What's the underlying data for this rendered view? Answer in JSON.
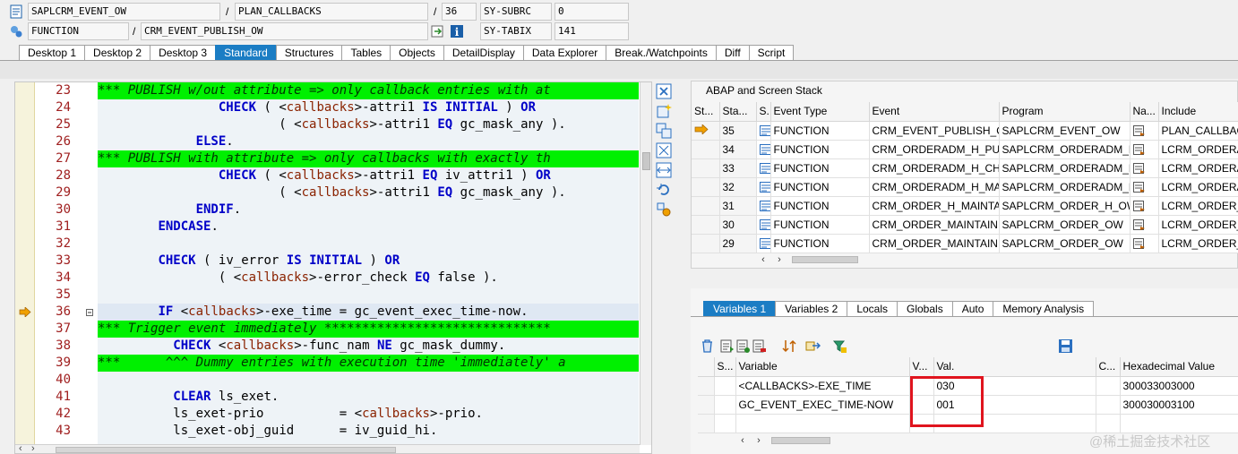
{
  "header": {
    "program_field": "SAPLCRM_EVENT_OW",
    "include_field": "PLAN_CALLBACKS",
    "line_field": "36",
    "subrc_label": "SY-SUBRC",
    "subrc_value": "0",
    "event_type_field": "FUNCTION",
    "event_field": "CRM_EVENT_PUBLISH_OW",
    "tabix_label": "SY-TABIX",
    "tabix_value": "141",
    "slash": "/"
  },
  "tabs": [
    "Desktop 1",
    "Desktop 2",
    "Desktop 3",
    "Standard",
    "Structures",
    "Tables",
    "Objects",
    "DetailDisplay",
    "Data Explorer",
    "Break./Watchpoints",
    "Diff",
    "Script"
  ],
  "active_tab": "Standard",
  "code": {
    "lines": [
      {
        "no": "23",
        "text": "*** PUBLISH w/out attribute => only callback entries with at",
        "green": true
      },
      {
        "no": "24",
        "text": "                CHECK ( <callbacks>-attri1 IS INITIAL ) OR"
      },
      {
        "no": "25",
        "text": "                        ( <callbacks>-attri1 EQ gc_mask_any )."
      },
      {
        "no": "26",
        "text": "             ELSE."
      },
      {
        "no": "27",
        "text": "*** PUBLISH with attribute => only callbacks with exactly th",
        "green": true
      },
      {
        "no": "28",
        "text": "                CHECK ( <callbacks>-attri1 EQ iv_attri1 ) OR"
      },
      {
        "no": "29",
        "text": "                        ( <callbacks>-attri1 EQ gc_mask_any )."
      },
      {
        "no": "30",
        "text": "             ENDIF."
      },
      {
        "no": "31",
        "text": "        ENDCASE."
      },
      {
        "no": "32",
        "text": ""
      },
      {
        "no": "33",
        "text": "        CHECK ( iv_error IS INITIAL ) OR"
      },
      {
        "no": "34",
        "text": "                ( <callbacks>-error_check EQ false )."
      },
      {
        "no": "35",
        "text": ""
      },
      {
        "no": "36",
        "text": "        IF <callbacks>-exe_time = gc_event_exec_time-now.",
        "current": true
      },
      {
        "no": "37",
        "text": "*** Trigger event immediately ******************************",
        "green": true
      },
      {
        "no": "38",
        "text": "          CHECK <callbacks>-func_nam NE gc_mask_dummy."
      },
      {
        "no": "39",
        "text": "***      ^^^ Dummy entries with execution time 'immediately' a",
        "green": true
      },
      {
        "no": "40",
        "text": ""
      },
      {
        "no": "41",
        "text": "          CLEAR ls_exet."
      },
      {
        "no": "42",
        "text": "          ls_exet-prio          = <callbacks>-prio."
      },
      {
        "no": "43",
        "text": "          ls_exet-obj_guid      = iv_guid_hi."
      }
    ],
    "keywords": [
      "CHECK",
      "IS",
      "INITIAL",
      "OR",
      "EQ",
      "ELSE",
      "ENDIF",
      "ENDCASE",
      "IF",
      "NE",
      "CLEAR"
    ]
  },
  "stack": {
    "title": "ABAP and Screen Stack",
    "columns": [
      "St...",
      "Sta...",
      "S...",
      "Event Type",
      "Event",
      "Program",
      "Na...",
      "Include"
    ],
    "rows": [
      {
        "level": "35",
        "type": "FUNCTION",
        "event": "CRM_EVENT_PUBLISH_O...",
        "program": "SAPLCRM_EVENT_OW",
        "include": "PLAN_CALLBACKS",
        "current": true
      },
      {
        "level": "34",
        "type": "FUNCTION",
        "event": "CRM_ORDERADM_H_PUB...",
        "program": "SAPLCRM_ORDERADM_H...",
        "include": "LCRM_ORDERADM_H..."
      },
      {
        "level": "33",
        "type": "FUNCTION",
        "event": "CRM_ORDERADM_H_CHA...",
        "program": "SAPLCRM_ORDERADM_H...",
        "include": "LCRM_ORDERADM_H..."
      },
      {
        "level": "32",
        "type": "FUNCTION",
        "event": "CRM_ORDERADM_H_MAI...",
        "program": "SAPLCRM_ORDERADM_H...",
        "include": "LCRM_ORDERADM_H..."
      },
      {
        "level": "31",
        "type": "FUNCTION",
        "event": "CRM_ORDER_H_MAINTA...",
        "program": "SAPLCRM_ORDER_H_OW",
        "include": "LCRM_ORDER_H_O..."
      },
      {
        "level": "30",
        "type": "FUNCTION",
        "event": "CRM_ORDER_MAINTAIN...",
        "program": "SAPLCRM_ORDER_OW",
        "include": "LCRM_ORDER_OW..."
      },
      {
        "level": "29",
        "type": "FUNCTION",
        "event": "CRM_ORDER_MAINTAIN...",
        "program": "SAPLCRM_ORDER_OW",
        "include": "LCRM_ORDER_OW..."
      }
    ]
  },
  "variables": {
    "tabs": [
      "Variables 1",
      "Variables 2",
      "Locals",
      "Globals",
      "Auto",
      "Memory Analysis"
    ],
    "active_tab": "Variables 1",
    "columns": [
      "S...",
      "Variable",
      "V...",
      "Val.",
      "C...",
      "Hexadecimal Value"
    ],
    "rows": [
      {
        "variable": "<CALLBACKS>-EXE_TIME",
        "value": "030",
        "hex": "300033003000"
      },
      {
        "variable": "GC_EVENT_EXEC_TIME-NOW",
        "value": "001",
        "hex": "300030003100"
      }
    ]
  },
  "watermark": "@稀土掘金技术社区",
  "colors": {
    "accent": "#1b7dc4",
    "comment_bg": "#00f000",
    "highlight": "#e0141e"
  }
}
